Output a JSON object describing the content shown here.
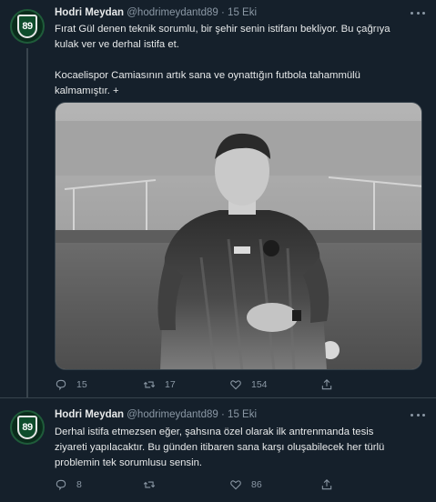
{
  "tweets": [
    {
      "name": "Hodri Meydan",
      "handle": "@hodrimeydantd89",
      "separator": "·",
      "date": "15 Eki",
      "avatar_text": "89",
      "lines_para1": [
        "Fırat Gül denen teknik sorumlu, bir şehir senin istifanı bekliyor. Bu çağrıya",
        "kulak ver ve derhal istifa et."
      ],
      "lines_para2": [
        "Kocaelispor Camiasının artık sana ve oynattığın futbola tahammülü",
        "kalmamıştır. +"
      ],
      "stats": {
        "replies": "15",
        "retweets": "17",
        "likes": "154"
      }
    },
    {
      "name": "Hodri Meydan",
      "handle": "@hodrimeydantd89",
      "separator": "·",
      "date": "15 Eki",
      "avatar_text": "89",
      "lines": [
        "Derhal istifa etmezsen eğer, şahsına özel olarak ilk antrenmanda tesis",
        "ziyareti yapılacaktır. Bu günden itibaren sana karşı oluşabilecek her türlü",
        "problemin tek sorumlusu sensin."
      ],
      "stats": {
        "replies": "8",
        "retweets": "",
        "likes": "86"
      }
    }
  ],
  "colors": {
    "background": "#15202b",
    "text_primary": "#e7e9ea",
    "text_secondary": "#8b98a5",
    "divider": "#38444d",
    "avatar_green": "#0f4d2c"
  },
  "icons": [
    "more-icon",
    "reply-icon",
    "retweet-icon",
    "like-icon",
    "share-icon"
  ]
}
